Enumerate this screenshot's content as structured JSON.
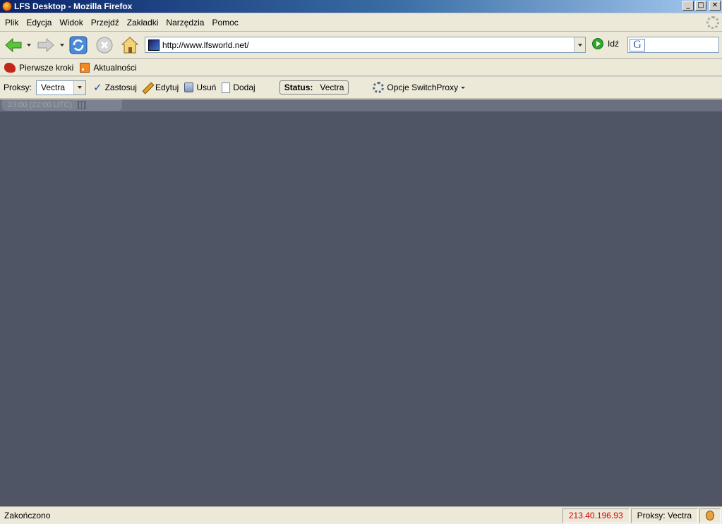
{
  "window": {
    "title": "LFS Desktop - Mozilla Firefox",
    "buttons": {
      "minimize": "_",
      "maximize": "□",
      "close": "✕"
    }
  },
  "menu": [
    "Plik",
    "Edycja",
    "Widok",
    "Przejdź",
    "Zakładki",
    "Narzędzia",
    "Pomoc"
  ],
  "nav": {
    "url": "http://www.lfsworld.net/",
    "go_label": "Idź",
    "search_engine": "G",
    "search_value": ""
  },
  "bookmarks": [
    "Pierwsze kroki",
    "Aktualności"
  ],
  "proxy": {
    "label": "Proksy:",
    "selected": "Vectra",
    "apply": "Zastosuj",
    "edit": "Edytuj",
    "remove": "Usuń",
    "add": "Dodaj",
    "status_label": "Status:",
    "status_value": "Vectra",
    "options": "Opcje SwitchProxy"
  },
  "content": {
    "clock": "23:00 (22:00 UTC)",
    "background_color": "#4f5565"
  },
  "statusbar": {
    "text": "Zakończono",
    "ip": "213.40.196.93",
    "proxy": "Proksy: Vectra"
  }
}
